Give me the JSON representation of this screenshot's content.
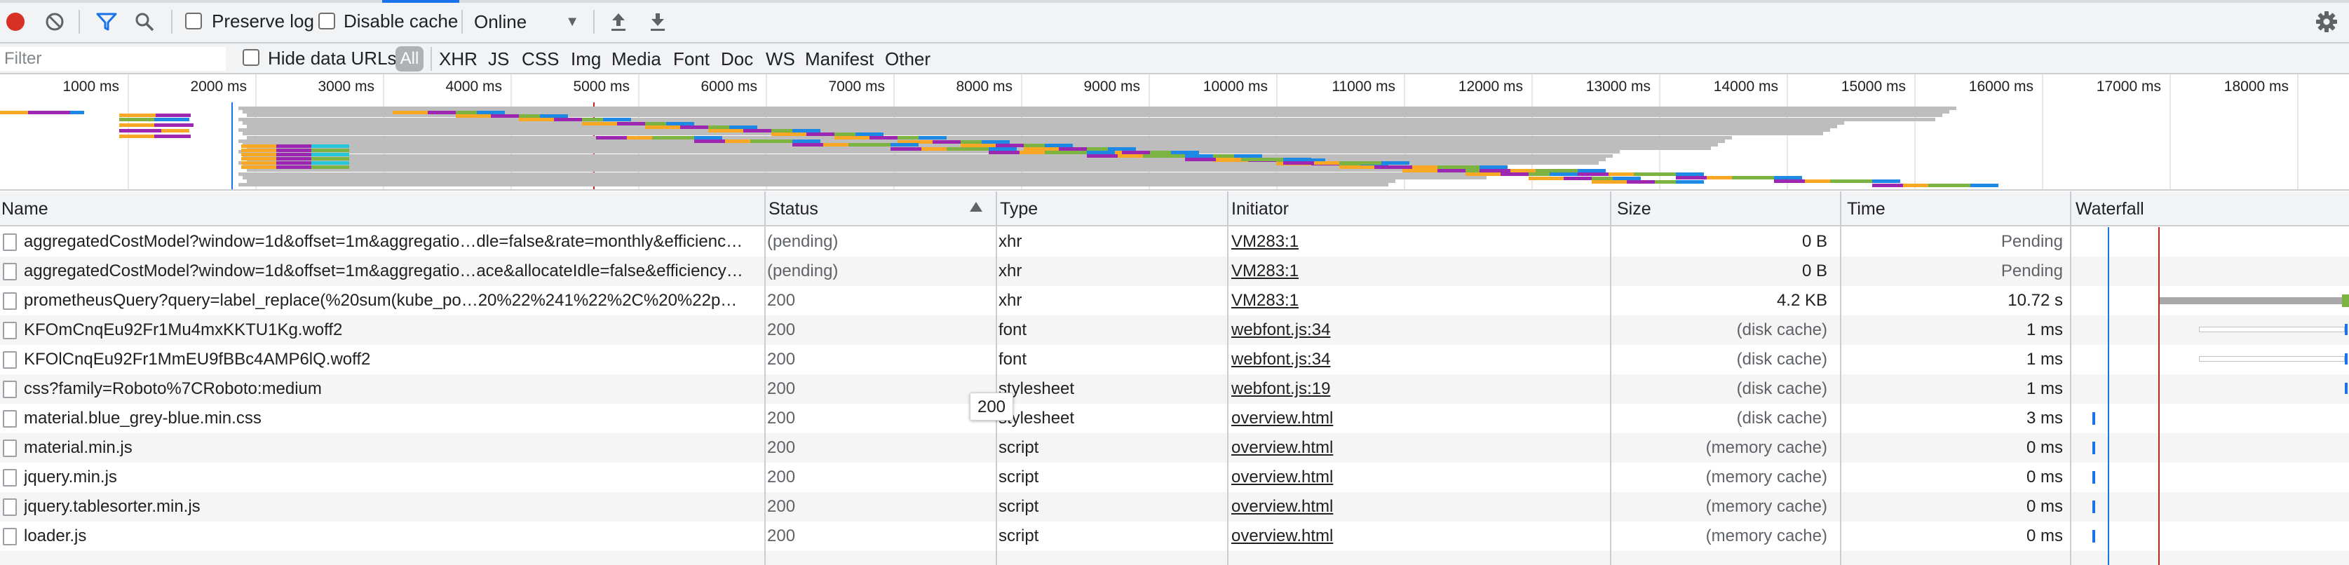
{
  "toolbar": {
    "record_icon": "record-icon",
    "clear_icon": "clear-icon",
    "filter_icon": "filter-icon",
    "search_icon": "search-icon",
    "preserve_log_label": "Preserve log",
    "preserve_log_checked": false,
    "disable_cache_label": "Disable cache",
    "disable_cache_checked": false,
    "throttling_value": "Online",
    "import_icon": "upload-icon",
    "export_icon": "download-icon",
    "settings_icon": "gear-icon",
    "record_color": "#d93025",
    "accent_color": "#1a73e8"
  },
  "filterbar": {
    "filter_placeholder": "Filter",
    "hide_data_urls_label": "Hide data URLs",
    "hide_data_urls_checked": false,
    "types": [
      "All",
      "XHR",
      "JS",
      "CSS",
      "Img",
      "Media",
      "Font",
      "Doc",
      "WS",
      "Manifest",
      "Other"
    ],
    "active_type": "All"
  },
  "overview": {
    "tick_labels": [
      "1000 ms",
      "2000 ms",
      "3000 ms",
      "4000 ms",
      "5000 ms",
      "6000 ms",
      "7000 ms",
      "8000 ms",
      "9000 ms",
      "10000 ms",
      "11000 ms",
      "12000 ms",
      "13000 ms",
      "14000 ms",
      "15000 ms",
      "16000 ms",
      "17000 ms",
      "18000 ms"
    ],
    "dom_content_loaded_color": "#1a73e8",
    "load_color": "#c5221f"
  },
  "table": {
    "columns": {
      "name": "Name",
      "status": "Status",
      "type": "Type",
      "initiator": "Initiator",
      "size": "Size",
      "time": "Time",
      "waterfall": "Waterfall"
    },
    "sorted_column": "Status",
    "sort_direction": "ascending",
    "rows": [
      {
        "name": "aggregatedCostModel?window=1d&offset=1m&aggregatio…dle=false&rate=monthly&efficienc…",
        "status": "(pending)",
        "type": "xhr",
        "initiator": "VM283:1",
        "size": "0 B",
        "time": "Pending"
      },
      {
        "name": "aggregatedCostModel?window=1d&offset=1m&aggregatio…ace&allocateIdle=false&efficiency…",
        "status": "(pending)",
        "type": "xhr",
        "initiator": "VM283:1",
        "size": "0 B",
        "time": "Pending"
      },
      {
        "name": "prometheusQuery?query=label_replace(%20sum(kube_po…20%22%241%22%2C%20%22p…",
        "status": "200",
        "type": "xhr",
        "initiator": "VM283:1",
        "size": "4.2 KB",
        "time": "10.72 s"
      },
      {
        "name": "KFOmCnqEu92Fr1Mu4mxKKTU1Kg.woff2",
        "status": "200",
        "type": "font",
        "initiator": "webfont.js:34",
        "size": "(disk cache)",
        "time": "1 ms"
      },
      {
        "name": "KFOlCnqEu92Fr1MmEU9fBBc4AMP6lQ.woff2",
        "status": "200",
        "type": "font",
        "initiator": "webfont.js:34",
        "size": "(disk cache)",
        "time": "1 ms"
      },
      {
        "name": "css?family=Roboto%7CRoboto:medium",
        "status": "200",
        "type": "stylesheet",
        "initiator": "webfont.js:19",
        "size": "(disk cache)",
        "time": "1 ms"
      },
      {
        "name": "material.blue_grey-blue.min.css",
        "status": "200",
        "type": "stylesheet",
        "initiator": "overview.html",
        "size": "(disk cache)",
        "time": "3 ms"
      },
      {
        "name": "material.min.js",
        "status": "200",
        "type": "script",
        "initiator": "overview.html",
        "size": "(memory cache)",
        "time": "0 ms"
      },
      {
        "name": "jquery.min.js",
        "status": "200",
        "type": "script",
        "initiator": "overview.html",
        "size": "(memory cache)",
        "time": "0 ms"
      },
      {
        "name": "jquery.tablesorter.min.js",
        "status": "200",
        "type": "script",
        "initiator": "overview.html",
        "size": "(memory cache)",
        "time": "0 ms"
      },
      {
        "name": "loader.js",
        "status": "200",
        "type": "script",
        "initiator": "overview.html",
        "size": "(memory cache)",
        "time": "0 ms"
      }
    ]
  },
  "tooltip": {
    "text": "200"
  }
}
